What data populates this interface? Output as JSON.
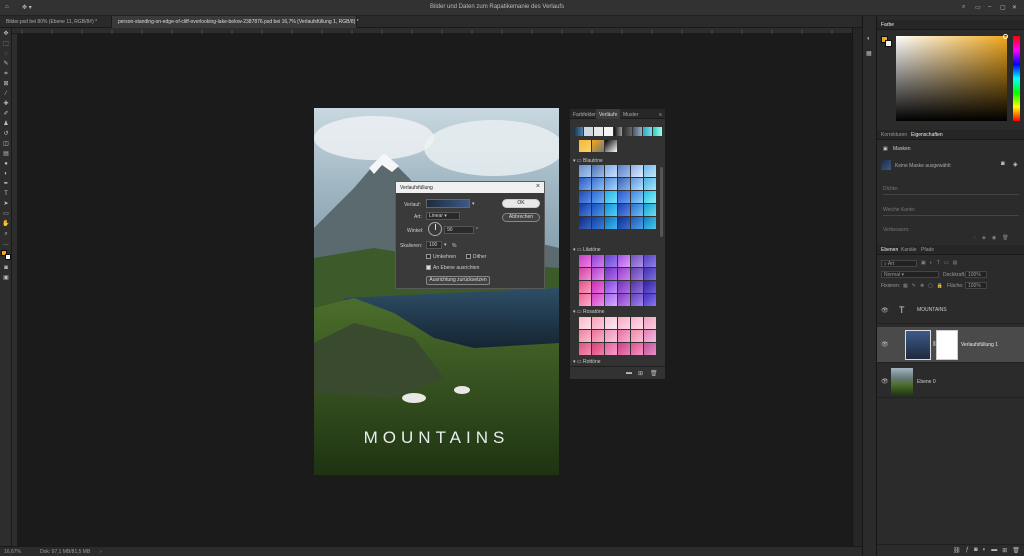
{
  "app": {
    "title": "Bilder und Daten zum Rapatikemanie des Verlaufs"
  },
  "tabs": [
    {
      "label": "Bilder.psd bei 80% (Ebene 11, RGB/8#) *",
      "active": false
    },
    {
      "label": "person-standing-on-edge-of-cliff-overlooking-lake-below-2387876.psd bei 16,7% (Verlaufsfüllung 1, RGB/8) *",
      "active": true
    }
  ],
  "document": {
    "title_text": "MOUNTAINS"
  },
  "status": {
    "zoom": "16,67%",
    "doc_info": "Dok: 97,1 MB/81,5 MB"
  },
  "dialog": {
    "title": "Verlaufsfüllung",
    "close": "×",
    "verlauf_label": "Verlauf:",
    "art_label": "Art:",
    "art_value": "Linear",
    "winkel_label": "Winkel:",
    "winkel_value": "90",
    "skalieren_label": "Skalieren:",
    "skalieren_value": "100",
    "percent": "%",
    "umkehren": "Umkehren",
    "dither": "Dither",
    "an_ebene": "An Ebene ausrichten",
    "ausrichtung": "Ausrichtung zurücksetzen",
    "ok": "OK",
    "abbrechen": "Abbrechen",
    "degree": "°"
  },
  "gradients_panel": {
    "tabs": [
      "Farbfelder",
      "Verläufe",
      "Muster"
    ],
    "active_tab": 1,
    "groups": [
      "Blautöne",
      "Lilatöne",
      "Rosatöne",
      "Rottöne"
    ]
  },
  "color_panel": {
    "title": "Farbe"
  },
  "properties_panel": {
    "tabs": [
      "Korrekturen",
      "Eigenschaften"
    ],
    "active_tab": 1,
    "section": "Masken",
    "mask_label": "Keine Maske ausgewählt",
    "fields": [
      "Dichte:",
      "Weiche Kante:",
      "Verbessern:"
    ]
  },
  "layers_panel": {
    "tabs": [
      "Ebenen",
      "Kanäle",
      "Pfade"
    ],
    "active_tab": 0,
    "search_placeholder": "Art",
    "blend_mode": "Normal",
    "opacity_label": "Deckkraft:",
    "opacity_value": "100%",
    "fixieren_label": "Fixieren:",
    "flaeche_label": "Fläche:",
    "flaeche_value": "100%",
    "layers": [
      {
        "name": "MOUNTAINS",
        "kind": "text"
      },
      {
        "name": "Verlaufsfüllung 1",
        "kind": "gradient-fill"
      },
      {
        "name": "Ebene 0",
        "kind": "image"
      }
    ]
  },
  "colors": {
    "accent_gradient_dark": "#2a3a55",
    "foreground": "#f0a81c",
    "background": "#f5f5f5"
  }
}
